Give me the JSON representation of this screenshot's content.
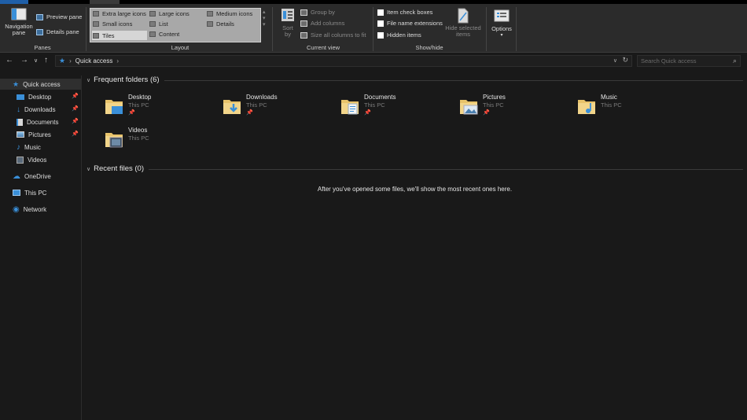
{
  "ribbon": {
    "panes": {
      "label": "Panes",
      "navigation_pane": "Navigation pane",
      "preview_pane": "Preview pane",
      "details_pane": "Details pane"
    },
    "layout": {
      "label": "Layout",
      "options": [
        "Extra large icons",
        "Large icons",
        "Medium icons",
        "Small icons",
        "List",
        "Details",
        "Tiles",
        "Content"
      ],
      "selected": "Tiles"
    },
    "current_view": {
      "label": "Current view",
      "sort_by": "Sort by",
      "group_by": "Group by",
      "add_columns": "Add columns",
      "size_all_columns": "Size all columns to fit"
    },
    "show_hide": {
      "label": "Show/hide",
      "item_check_boxes": "Item check boxes",
      "file_name_extensions": "File name extensions",
      "hidden_items": "Hidden items",
      "hide_selected_items": "Hide selected items"
    },
    "options": {
      "label": "Options"
    }
  },
  "address": {
    "path": "Quick access",
    "search_placeholder": "Search Quick access"
  },
  "sidebar": {
    "items": [
      {
        "label": "Quick access",
        "icon": "star-icon",
        "active": true
      },
      {
        "label": "Desktop",
        "icon": "desktop-icon",
        "pinned": true
      },
      {
        "label": "Downloads",
        "icon": "download-icon",
        "pinned": true
      },
      {
        "label": "Documents",
        "icon": "documents-icon",
        "pinned": true
      },
      {
        "label": "Pictures",
        "icon": "pictures-icon",
        "pinned": true
      },
      {
        "label": "Music",
        "icon": "music-icon"
      },
      {
        "label": "Videos",
        "icon": "videos-icon"
      },
      {
        "label": "OneDrive",
        "icon": "cloud-icon"
      },
      {
        "label": "This PC",
        "icon": "computer-icon"
      },
      {
        "label": "Network",
        "icon": "network-icon"
      }
    ]
  },
  "frequent": {
    "title": "Frequent folders (6)",
    "folders": [
      {
        "name": "Desktop",
        "location": "This PC",
        "pinned": true
      },
      {
        "name": "Downloads",
        "location": "This PC",
        "pinned": true
      },
      {
        "name": "Documents",
        "location": "This PC",
        "pinned": true
      },
      {
        "name": "Pictures",
        "location": "This PC",
        "pinned": true
      },
      {
        "name": "Music",
        "location": "This PC",
        "pinned": false
      },
      {
        "name": "Videos",
        "location": "This PC",
        "pinned": false
      }
    ]
  },
  "recent": {
    "title": "Recent files (0)",
    "empty_message": "After you've opened some files, we'll show the most recent ones here."
  },
  "colors": {
    "accent": "#3a8fd8",
    "folder_yellow": "#e8c36b",
    "background": "#191919",
    "ribbon": "#2b2b2b"
  }
}
